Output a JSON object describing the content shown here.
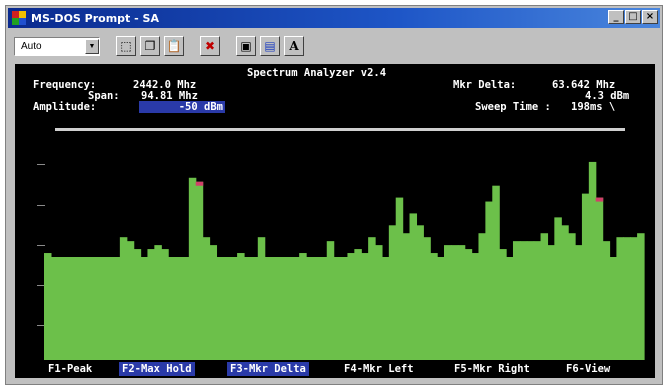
{
  "window": {
    "title": "MS-DOS Prompt - SA"
  },
  "toolbar": {
    "font_size": "Auto",
    "font_button": "A"
  },
  "analyzer": {
    "heading": "Spectrum Analyzer v2.4",
    "frequency_label": "Frequency:",
    "frequency_value": "2442.0 Mhz",
    "span_label": "Span:",
    "span_value": "94.81 Mhz",
    "amplitude_label": "Amplitude:",
    "amplitude_value": "-50 dBm",
    "mkr_delta_label": "Mkr Delta:",
    "mkr_delta_value": "63.642 Mhz",
    "mkr_delta_db": "4.3 dBm",
    "sweep_label": "Sweep Time :",
    "sweep_value": "198ms \\"
  },
  "function_keys": [
    {
      "label": "F1-Peak",
      "active": false
    },
    {
      "label": "F2-Max Hold",
      "active": true
    },
    {
      "label": "F3-Mkr Delta",
      "active": true
    },
    {
      "label": "F4-Mkr Left",
      "active": false
    },
    {
      "label": "F5-Mkr Right",
      "active": false
    },
    {
      "label": "F6-View",
      "active": false
    }
  ],
  "chart_data": {
    "type": "bar",
    "bar_color": "#6cc04a",
    "marker_color": "#d0406a",
    "values": [
      27,
      26,
      26,
      26,
      26,
      26,
      26,
      26,
      26,
      26,
      26,
      31,
      30,
      28,
      26,
      28,
      29,
      28,
      26,
      26,
      26,
      46,
      45,
      31,
      29,
      26,
      26,
      26,
      27,
      26,
      26,
      31,
      26,
      26,
      26,
      26,
      26,
      27,
      26,
      26,
      26,
      30,
      26,
      26,
      27,
      28,
      27,
      31,
      29,
      26,
      34,
      41,
      32,
      37,
      34,
      31,
      27,
      26,
      29,
      29,
      29,
      28,
      27,
      32,
      40,
      44,
      28,
      26,
      30,
      30,
      30,
      30,
      32,
      29,
      36,
      34,
      32,
      29,
      42,
      50,
      41,
      30,
      26,
      31,
      31,
      31,
      32
    ],
    "markers": [
      22,
      80
    ]
  }
}
